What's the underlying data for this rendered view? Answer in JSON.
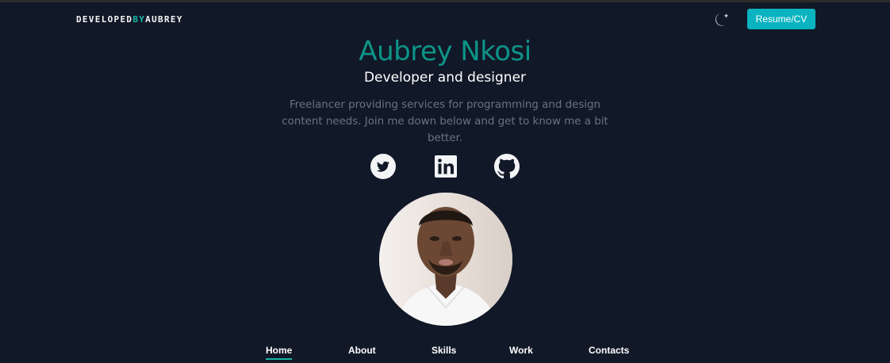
{
  "brand": {
    "part1": "DEVELOPED",
    "part2": "BY",
    "part3": "AUBREY"
  },
  "header": {
    "resume_label": "Resume/CV",
    "theme_icon": "moon-icon"
  },
  "hero": {
    "name": "Aubrey Nkosi",
    "role": "Developer and designer",
    "bio": "Freelancer providing services for programming and design content needs. Join me down below and get to know me a bit better."
  },
  "social": [
    {
      "name": "twitter",
      "icon": "twitter-icon"
    },
    {
      "name": "linkedin",
      "icon": "linkedin-icon"
    },
    {
      "name": "github",
      "icon": "github-icon"
    }
  ],
  "nav": {
    "items": [
      {
        "label": "Home",
        "active": true
      },
      {
        "label": "About"
      },
      {
        "label": "Skills"
      },
      {
        "label": "Work"
      },
      {
        "label": "Contacts"
      }
    ]
  },
  "colors": {
    "background": "#111827",
    "accent": "#14b8a6",
    "button": "#0ab3c0",
    "name": "#0d9488",
    "bio": "#6b7280"
  }
}
